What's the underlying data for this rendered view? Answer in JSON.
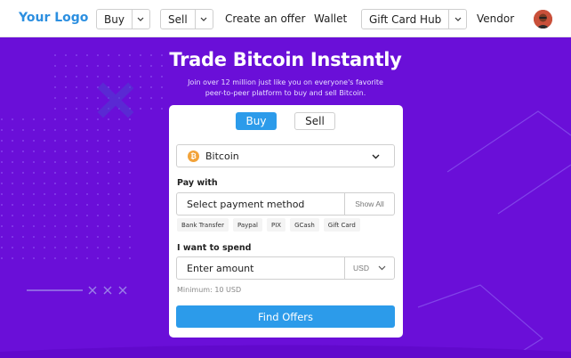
{
  "header": {
    "logo": "Your Logo",
    "nav": {
      "buy": "Buy",
      "sell": "Sell",
      "create_offer": "Create an offer",
      "wallet": "Wallet",
      "gift_card_hub": "Gift Card Hub",
      "vendor": "Vendor"
    },
    "avatar_icon": "user-avatar"
  },
  "hero": {
    "title": "Trade Bitcoin Instantly",
    "subtitle_line1": "Join over 12 million just like you on everyone's favorite",
    "subtitle_line2": "peer-to-peer platform to buy and sell Bitcoin."
  },
  "card": {
    "tabs": {
      "buy": "Buy",
      "sell": "Sell",
      "active": "buy"
    },
    "coin": {
      "label": "Bitcoin",
      "icon": "bitcoin-icon",
      "symbol": "₿"
    },
    "pay_with": {
      "label": "Pay with",
      "placeholder": "Select payment method",
      "show_all": "Show All",
      "chips": [
        "Bank Transfer",
        "Paypal",
        "PIX",
        "GCash",
        "Gift Card"
      ]
    },
    "spend": {
      "label": "I want to spend",
      "placeholder": "Enter amount",
      "currency": "USD"
    },
    "minimum": "Minimum: 10 USD",
    "find_button": "Find Offers"
  },
  "colors": {
    "background": "#6a0fd8",
    "accent": "#2c9bea",
    "logo": "#2c8fe0",
    "bitcoin": "#f2a33a"
  }
}
